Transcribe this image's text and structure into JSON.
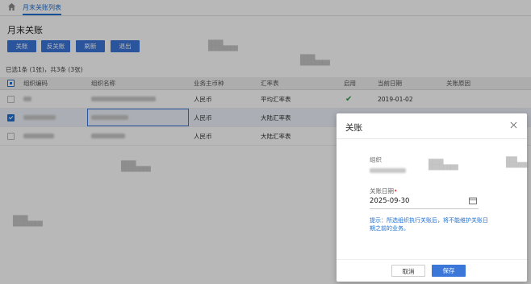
{
  "nav": {
    "breadcrumb": "月末关账列表"
  },
  "page": {
    "title": "月末关账"
  },
  "toolbar": {
    "close": "关账",
    "reverse": "反关账",
    "refresh": "刷新",
    "exit": "退出"
  },
  "summary": "已选1条 (1张)，共3条 (3张)",
  "table": {
    "headers": [
      "组织编码",
      "组织名称",
      "业务主币种",
      "汇率表",
      "启用",
      "当前日期",
      "关账原因"
    ],
    "rows": [
      {
        "currency": "人民币",
        "rate_table": "平均汇率表",
        "enabled": true,
        "current_date": "2019-01-02",
        "reason": "",
        "selected": false
      },
      {
        "currency": "人民币",
        "rate_table": "大陆汇率表",
        "enabled": false,
        "current_date": "",
        "reason": "",
        "selected": true
      },
      {
        "currency": "人民币",
        "rate_table": "大陆汇率表",
        "enabled": false,
        "current_date": "",
        "reason": "",
        "selected": false
      }
    ]
  },
  "dialog": {
    "title": "关账",
    "org_label": "组织",
    "date_label": "关账日期",
    "required_mark": "•",
    "date_value": "2025-09-30",
    "tip": "提示：所选组织执行关账后，将不能维护关账日期之前的业务。",
    "cancel": "取消",
    "save": "保存"
  },
  "colors": {
    "accent": "#3b77d8",
    "tip": "#1f6fd1",
    "success": "#2aa24b"
  }
}
